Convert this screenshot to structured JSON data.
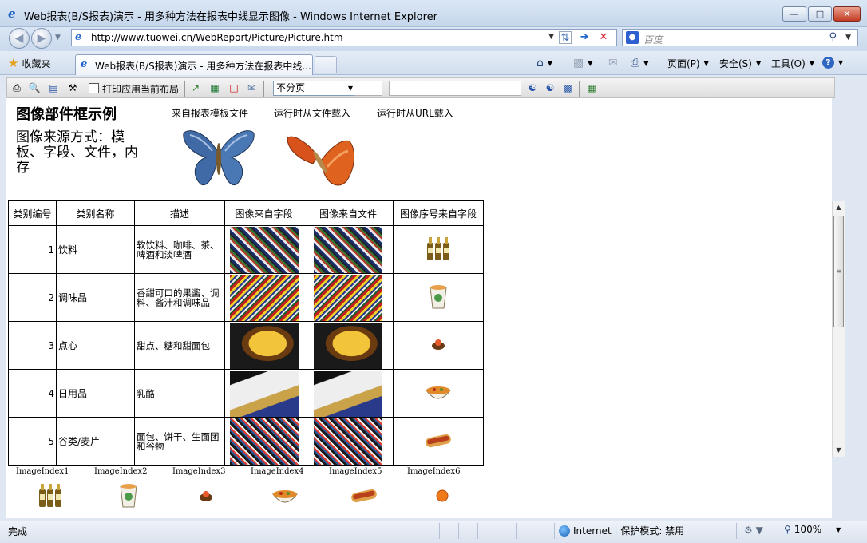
{
  "window": {
    "title": "Web报表(B/S报表)演示 - 用多种方法在报表中线显示图像 - Windows Internet Explorer"
  },
  "address": {
    "url": "http://www.tuowei.cn/WebReport/Picture/Picture.htm",
    "search_placeholder": "百度"
  },
  "tabs": {
    "favorites_label": "收藏夹",
    "active_tab_label": "Web报表(B/S报表)演示 - 用多种方法在报表中线...",
    "commands": [
      {
        "label": "页面(P)"
      },
      {
        "label": "安全(S)"
      },
      {
        "label": "工具(O)"
      }
    ]
  },
  "report_toolbar": {
    "checkbox_label": "打印应用当前布局",
    "paging_select_value": "不分页"
  },
  "report": {
    "heading": "图像部件框示例",
    "top_labels": [
      "来自报表模板文件",
      "运行时从文件载入",
      "运行时从URL载入"
    ],
    "source_desc": "图像来源方式：模板、字段、文件，内存",
    "columns": [
      "类别编号",
      "类别名称",
      "描述",
      "图像来自字段",
      "图像来自文件",
      "图像序号来自字段"
    ],
    "rows": [
      {
        "id": "1",
        "name": "饮料",
        "desc": "软饮料、咖啡、茶、啤酒和淡啤酒",
        "icon": "beer-bottles-icon"
      },
      {
        "id": "2",
        "name": "调味品",
        "desc": "香甜可口的果酱、调料、酱汁和调味品",
        "icon": "cup-icon"
      },
      {
        "id": "3",
        "name": "点心",
        "desc": "甜点、糖和甜面包",
        "icon": "dessert-icon"
      },
      {
        "id": "4",
        "name": "日用品",
        "desc": "乳酪",
        "icon": "bowl-icon"
      },
      {
        "id": "5",
        "name": "谷类/麦片",
        "desc": "面包、饼干、生面团和谷物",
        "icon": "hotdog-icon"
      }
    ],
    "image_index_labels": [
      "ImageIndex1",
      "ImageIndex2",
      "ImageIndex3",
      "ImageIndex4",
      "ImageIndex5",
      "ImageIndex6"
    ]
  },
  "status": {
    "text": "完成",
    "zone": "Internet | 保护模式: 禁用",
    "zoom": "100%"
  },
  "colors": {
    "title_bar": "#c5d6ec",
    "close_button": "#c33b23",
    "content_bg": "#ffffff"
  }
}
